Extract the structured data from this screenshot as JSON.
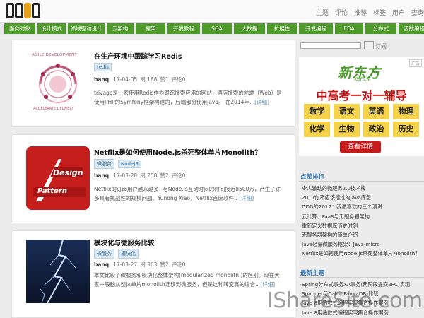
{
  "header": {
    "logo_text": "JDON",
    "links": [
      "主题",
      "评论",
      "推荐",
      "标签",
      "用户",
      "查询"
    ]
  },
  "nav": [
    {
      "label": "面向对象"
    },
    {
      "label": "设计模式"
    },
    {
      "label": "领域驱动设计"
    },
    {
      "label": "云架构"
    },
    {
      "label": "框架"
    },
    {
      "label": "开发教程"
    },
    {
      "label": "SOA"
    },
    {
      "label": "大数据"
    },
    {
      "label": "扩展性"
    },
    {
      "label": "开发编程"
    },
    {
      "label": "EDA"
    },
    {
      "label": "分布式"
    },
    {
      "label": "函数编程"
    }
  ],
  "articles": [
    {
      "title": "在生产环境中跟踪学习Redis",
      "thumb_icon": "agile-development-diagram",
      "thumb_text_top": "AGILE DEVELOPMENT",
      "thumb_text_bottom": "ACCELERATE DELIVERY",
      "tags": [
        "redis"
      ],
      "author": "banq",
      "date": "17-04-05",
      "views": "阅 188",
      "likes": "赞1",
      "comments": "评论0",
      "description": "trivago是一家使用Redis作为跟踪搜索应用的网站，酒店搜索的前端（Web）是使用PHP的Symfony框架构建的，后端部分使用Java。 在2014年..",
      "more": "[详细]"
    },
    {
      "title": "Netflix是如何使用Node.js杀死整体单片Monolith？",
      "thumb_icon": "design-pattern-logo",
      "thumb_text_top": "Design",
      "thumb_text_bottom": "Pattern",
      "tags": [
        "微服务",
        "NodeJS"
      ],
      "author": "banq",
      "date": "17-03-28",
      "views": "阅 258",
      "likes": "赞2",
      "comments": "评论0",
      "description": "Netflix的订阅用户越来越多--与Node.js互动时间的时间接近8500万，产生了许多具有挑战性的规模问题。Yunong Xiao，Netflix首席软件..",
      "more": "[详细]"
    },
    {
      "title": "模块化与微服务比较",
      "thumb_icon": "lightning-photo",
      "thumb_text_top": "",
      "thumb_text_bottom": "",
      "tags": [
        "微服务",
        "模块化"
      ],
      "author": "banq",
      "date": "17-03-27",
      "views": "阅 363",
      "likes": "赞2",
      "comments": "评论0",
      "description": "本文比较了微服务和模块化整体架构(modularized monolith )的区别。现在大家一般脑从整体单片monolith迁移到微服务，但是这种转变真的适合..",
      "more": "[详细]"
    }
  ],
  "sidebar": {
    "search_placeholder": "",
    "subscribe_label": "订阅",
    "ad": {
      "brand": "新东方",
      "brand_sub": "XDF.CN",
      "badge": "广告",
      "headline": "中高考一对一辅导",
      "subjects": [
        "数学",
        "语文",
        "英语",
        "物理",
        "化学",
        "生物",
        "政治",
        "历史"
      ],
      "cta": "查看详情"
    },
    "rank_title": "点赞排行",
    "rank_items": [
      "令人激动的微服务2.0技术栈",
      "2017你不应该错过的Java库包",
      "DDD的2017：我最喜欢的三个演讲",
      "云计算、FaaS与无服务器架构",
      "重新定义数据库历史时刻",
      "无服务器架构的简单介绍",
      "Java轻量微服务框架：Java-micro",
      "Netflix是如何使用Node.js杀死整体单片Monolith？"
    ],
    "latest_title": "最新主题",
    "latest_items": [
      "Spring分布式事务XA事务(两阶段提交2PC)实现",
      "Spanner与CalvinFaunaDB)比较",
      "Java 8用函数式编程实现集合操作案例",
      "Java 8用函数式编程实现集合操作案例"
    ]
  },
  "watermark": "IShareSite.com"
}
